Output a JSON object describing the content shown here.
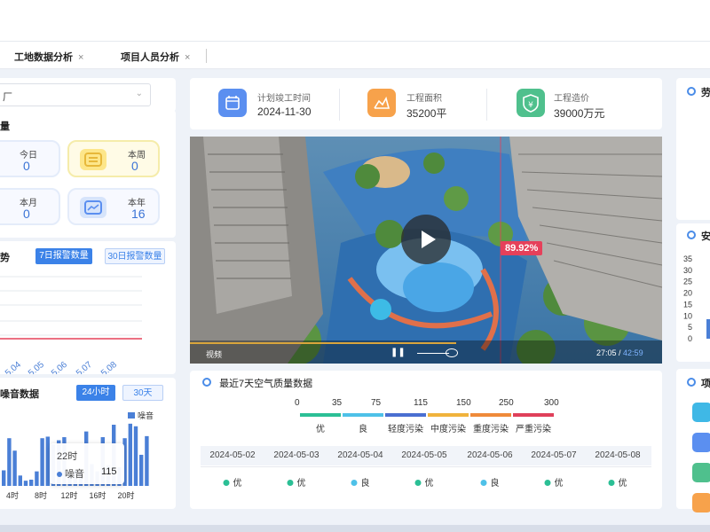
{
  "tabs": [
    {
      "label": "工地数据分析",
      "close": "×"
    },
    {
      "label": "项目人员分析",
      "close": "×"
    }
  ],
  "left": {
    "select_value": "厂",
    "stats_title": "量",
    "stats": [
      {
        "label": "今日",
        "value": "0"
      },
      {
        "label": "本周",
        "value": "0"
      },
      {
        "label": "本月",
        "value": "0"
      },
      {
        "label": "本年",
        "value": "16"
      }
    ],
    "trend_title": "势",
    "trend_btn_active": "7日报警数量",
    "trend_btn_inactive": "30日报警数量",
    "noise_title": "噪音数据",
    "noise_btn_active": "24小时",
    "noise_btn_inactive": "30天",
    "noise_legend": "噪音",
    "tooltip_time": "22时",
    "tooltip_label": "噪音",
    "tooltip_value": "115"
  },
  "metrics": [
    {
      "label": "计划竣工时间",
      "value": "2024-11-30",
      "icon": "calendar-icon",
      "color": "#5b8ff0"
    },
    {
      "label": "工程面积",
      "value": "35200平",
      "icon": "area-icon",
      "color": "#f7a24b"
    },
    {
      "label": "工程造价",
      "value": "39000万元",
      "icon": "price-shield-icon",
      "color": "#4fc08d"
    }
  ],
  "video": {
    "badge": "89.92%",
    "label": "视频",
    "time": "27:05",
    "duration": "42:59"
  },
  "air_quality": {
    "title": "最近7天空气质量数据",
    "scale": [
      "0",
      "35",
      "75",
      "115",
      "150",
      "250",
      "300"
    ],
    "levels": [
      {
        "label": "优",
        "color": "#2bbf95"
      },
      {
        "label": "良",
        "color": "#4ec1e8"
      },
      {
        "label": "轻度污染",
        "color": "#4a6fd1"
      },
      {
        "label": "中度污染",
        "color": "#f0b33c"
      },
      {
        "label": "重度污染",
        "color": "#ef8a3a"
      },
      {
        "label": "严重污染",
        "color": "#e0405a"
      }
    ],
    "dates": [
      "2024-05-02",
      "2024-05-03",
      "2024-05-04",
      "2024-05-05",
      "2024-05-06",
      "2024-05-07",
      "2024-05-08"
    ],
    "values": [
      {
        "label": "优",
        "color": "#2bbf95"
      },
      {
        "label": "优",
        "color": "#2bbf95"
      },
      {
        "label": "良",
        "color": "#4ec1e8"
      },
      {
        "label": "优",
        "color": "#2bbf95"
      },
      {
        "label": "良",
        "color": "#4ec1e8"
      },
      {
        "label": "优",
        "color": "#2bbf95"
      },
      {
        "label": "优",
        "color": "#2bbf95"
      }
    ]
  },
  "right": {
    "titles": [
      "劳",
      "安",
      "项"
    ]
  },
  "chart_data": [
    {
      "type": "line",
      "categories": [
        "5.04",
        "5.05",
        "5.06",
        "5.07",
        "5.08"
      ],
      "values": [
        0,
        0,
        0,
        0,
        0
      ]
    },
    {
      "type": "bar",
      "x_ticks": [
        "4时",
        "8时",
        "12时",
        "16时",
        "20时"
      ],
      "series": [
        {
          "name": "噪音",
          "values": [
            30,
            92,
            68,
            20,
            10,
            12,
            28,
            92,
            95,
            80,
            88,
            94,
            22,
            30,
            28,
            105,
            42,
            28,
            94,
            40,
            118,
            36,
            92,
            120,
            115,
            60,
            96
          ]
        }
      ]
    },
    {
      "type": "bar",
      "y_ticks": [
        "0",
        "5",
        "10",
        "15",
        "20",
        "25",
        "30",
        "35"
      ],
      "ylim": [
        0,
        35
      ]
    }
  ]
}
